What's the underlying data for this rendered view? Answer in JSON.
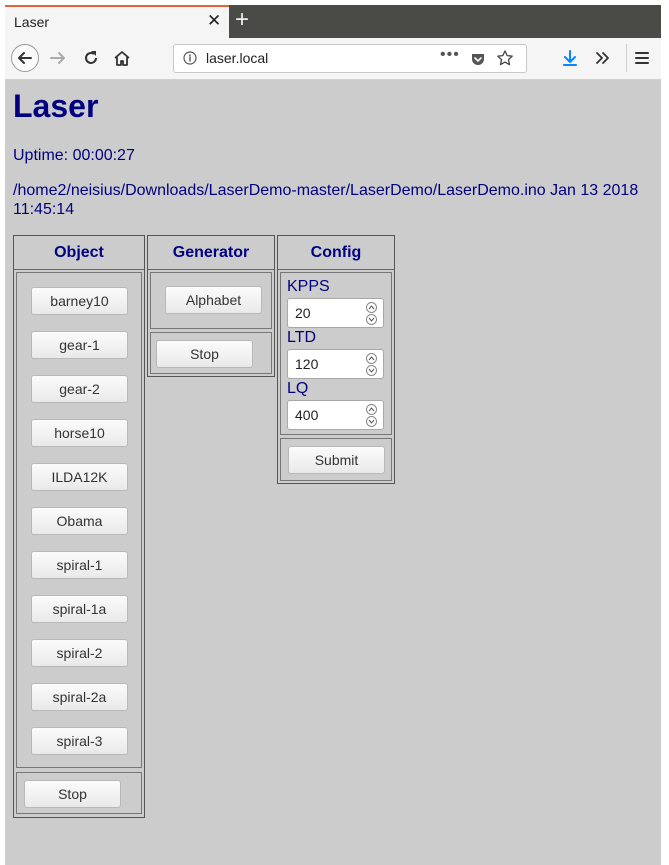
{
  "browser": {
    "tab_title": "Laser",
    "tab_close_glyph": "✕",
    "new_tab_glyph": "+",
    "url": "laser.local",
    "url_more_glyph": "•••"
  },
  "page": {
    "title": "Laser",
    "uptime": "Uptime: 00:00:27",
    "path": "/home2/neisius/Downloads/LaserDemo-master/LaserDemo/LaserDemo.ino Jan 13 2018 11:45:14"
  },
  "object_panel": {
    "header": "Object",
    "items": [
      "barney10",
      "gear-1",
      "gear-2",
      "horse10",
      "ILDA12K",
      "Obama",
      "spiral-1",
      "spiral-1a",
      "spiral-2",
      "spiral-2a",
      "spiral-3"
    ],
    "stop_label": "Stop"
  },
  "generator_panel": {
    "header": "Generator",
    "items": [
      "Alphabet"
    ],
    "stop_label": "Stop"
  },
  "config_panel": {
    "header": "Config",
    "fields": [
      {
        "label": "KPPS",
        "value": "20"
      },
      {
        "label": "LTD",
        "value": "120"
      },
      {
        "label": "LQ",
        "value": "400"
      }
    ],
    "submit_label": "Submit"
  },
  "colors": {
    "text_navy": "#000080",
    "page_bg": "#cccccc",
    "tab_accent": "#e0643a",
    "download_icon": "#0a84ff"
  }
}
